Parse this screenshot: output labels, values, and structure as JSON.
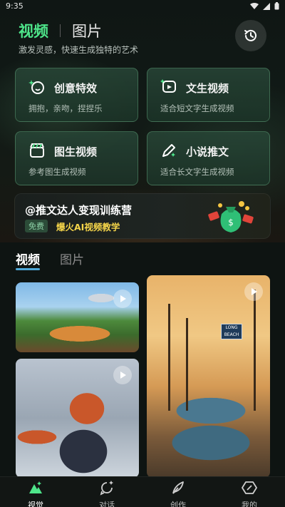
{
  "status_bar": {
    "time": "9:35"
  },
  "header": {
    "tabs": [
      {
        "label": "视频",
        "active": true
      },
      {
        "label": "图片",
        "active": false
      }
    ],
    "subtitle": "激发灵感，快速生成独特的艺术",
    "history_icon": "history-icon"
  },
  "features": [
    {
      "title": "创意特效",
      "desc": "拥抱，亲吻，捏捏乐",
      "icon": "sparkle-face-icon"
    },
    {
      "title": "文生视频",
      "desc": "适合短文字生成视频",
      "icon": "text-video-icon"
    },
    {
      "title": "图生视频",
      "desc": "参考图生成视频",
      "icon": "clapboard-icon"
    },
    {
      "title": "小说推文",
      "desc": "适合长文字生成视频",
      "icon": "pen-sparkle-icon"
    }
  ],
  "banner": {
    "title": "@推文达人变现训练营",
    "badge": "免费",
    "subtitle": "爆火AI视频教学"
  },
  "content_tabs": [
    {
      "label": "视频",
      "active": true
    },
    {
      "label": "图片",
      "active": false
    }
  ],
  "gallery": {
    "tile3_sign": "LONG BEACH"
  },
  "bottom_nav": [
    {
      "label": "视觉",
      "icon": "mountain-icon",
      "active": true
    },
    {
      "label": "对话",
      "icon": "chat-sparkle-icon",
      "active": false
    },
    {
      "label": "创作",
      "icon": "feather-icon",
      "active": false
    },
    {
      "label": "我的",
      "icon": "hexagon-icon",
      "active": false
    }
  ],
  "colors": {
    "accent": "#4ee58a",
    "tab_underline": "#4ea8d8",
    "banner_highlight": "#f5d54a"
  }
}
